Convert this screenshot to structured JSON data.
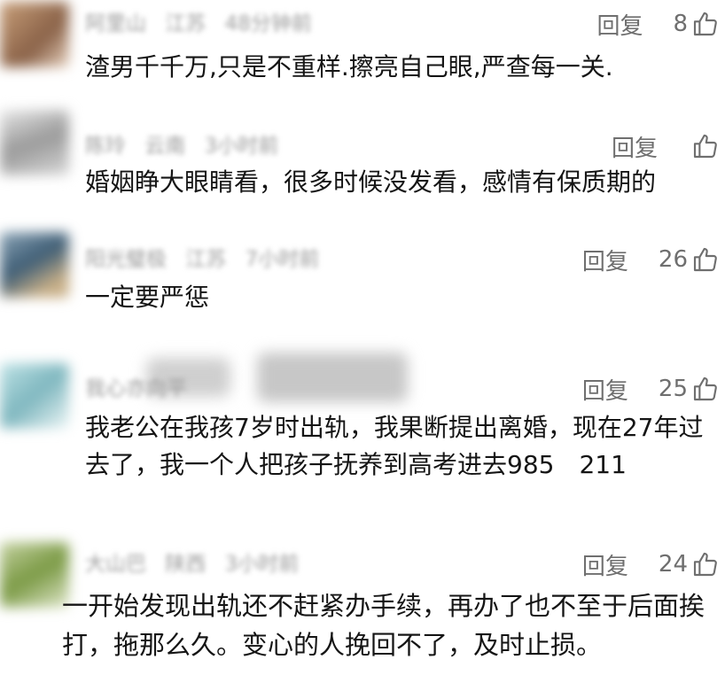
{
  "comments": [
    {
      "user": "阿里山",
      "location": "江苏",
      "time": "48分钟前",
      "reply_label": "回复",
      "likes": "8",
      "text": "渣男千千万,只是不重样.擦亮自己眼,严查每一关."
    },
    {
      "user": "陈玲",
      "location": "云南",
      "time": "3小时前",
      "reply_label": "回复",
      "likes": "",
      "text": "婚姻睁大眼睛看，很多时候没发看，感情有保质期的"
    },
    {
      "user": "阳光璧极",
      "location": "江苏",
      "time": "7小时前",
      "reply_label": "回复",
      "likes": "26",
      "text": "一定要严惩"
    },
    {
      "user": "我心亦向平",
      "location": "",
      "time": "",
      "reply_label": "回复",
      "likes": "25",
      "text": "我老公在我孩7岁时出轨，我果断提出离婚，现在27年过去了，我一个人把孩子抚养到高考进去985　211"
    },
    {
      "user": "大山巴",
      "location": "陕西",
      "time": "3小时前",
      "reply_label": "回复",
      "likes": "24",
      "text": "一开始发现出轨还不赶紧办手续，再办了也不至于后面挨打，拖那么久。变心的人挽回不了，及时止损。"
    }
  ],
  "icons": {
    "like": "thumbs-up-icon"
  },
  "colors": {
    "meta": "#9a9a9a",
    "action": "#6f6f6f",
    "text": "#151515"
  }
}
